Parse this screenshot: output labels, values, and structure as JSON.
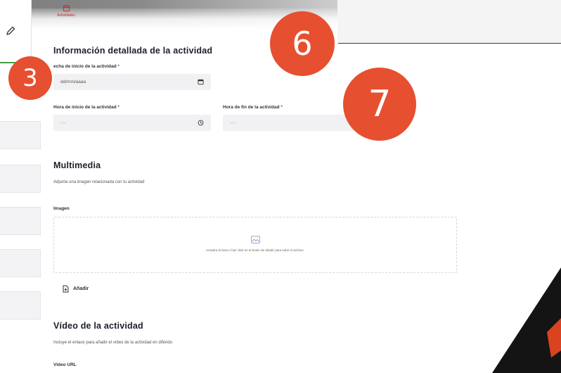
{
  "tab": {
    "label": "Actividades",
    "icon": "calendar-icon",
    "color": "#c62828"
  },
  "sections": {
    "details_title": "Información detallada de la actividad",
    "multimedia_title": "Multimedia",
    "multimedia_subtitle": "Adjunta una imagen relacionada con tu actividad",
    "video_title": "Vídeo de la actividad",
    "video_subtitle": "Incluye el enlace para añadir el vídeo de la actividad en diferido"
  },
  "fields": {
    "start_date": {
      "label": "echa de inicio de la actividad",
      "required_mark": "*",
      "placeholder": "dd/mm/aaaa"
    },
    "start_time": {
      "label": "Hora de inicio de la actividad",
      "required_mark": "*",
      "placeholder": "--:--"
    },
    "end_time": {
      "label": "Hora de fin de la actividad",
      "required_mark": "*",
      "placeholder": "--:--"
    },
    "image": {
      "label": "Imagen",
      "drop_text": "Arrastra al área o haz click en el botón de añadir para subir el archivo."
    },
    "video_url": {
      "label": "Video URL"
    }
  },
  "add_button": {
    "label": "Añadir"
  },
  "badges": [
    "3",
    "6",
    "7"
  ],
  "colors": {
    "badge": "#e64f2f",
    "accent_green": "#43a047",
    "required": "#1976d2"
  }
}
